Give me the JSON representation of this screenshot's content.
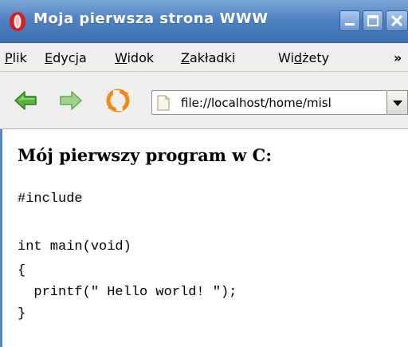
{
  "window": {
    "title": "Moja pierwsza strona WWW"
  },
  "menu": {
    "items": [
      {
        "first": "P",
        "rest": "lik"
      },
      {
        "first": "E",
        "rest": "dycja"
      },
      {
        "first": "W",
        "rest": "idok"
      },
      {
        "first": "Z",
        "rest": "akładki"
      },
      {
        "pre": "Wi",
        "first": "d",
        "rest": "żety"
      }
    ],
    "more": "»"
  },
  "toolbar": {
    "url": "file://localhost/home/misl",
    "icons": [
      "back-arrow-icon",
      "forward-arrow-icon",
      "reload-icon",
      "page-icon",
      "dropdown-arrow-icon"
    ]
  },
  "page": {
    "heading": "Mój pierwszy program w C:",
    "code_lines": [
      "#include",
      "",
      "int main(void)",
      "{",
      "  printf(\" Hello world! \");",
      "}"
    ]
  },
  "colors": {
    "titlebar": "#4f82c2",
    "menubar": "#eeeeec",
    "arrow_green": "#4aa02c",
    "reload_orange": "#f08a16"
  }
}
